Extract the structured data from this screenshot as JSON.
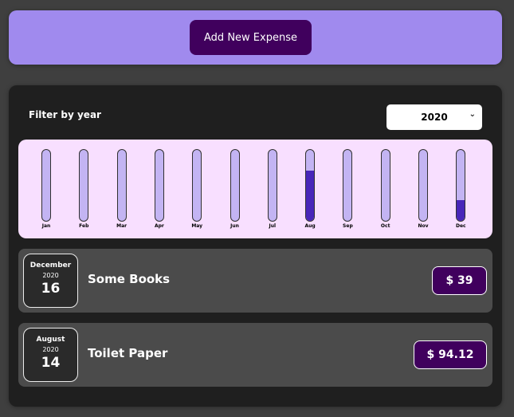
{
  "new_expense": {
    "add_button_label": "Add New Expense"
  },
  "filter": {
    "label": "Filter by year",
    "selected_year": "2020",
    "chevron_icon": "chevron-down-icon"
  },
  "chart_data": {
    "type": "bar",
    "categories": [
      "Jan",
      "Feb",
      "Mar",
      "Apr",
      "May",
      "Jun",
      "Jul",
      "Aug",
      "Sep",
      "Oct",
      "Nov",
      "Dec"
    ],
    "values": [
      0,
      0,
      0,
      0,
      0,
      0,
      0,
      94.12,
      0,
      0,
      0,
      39
    ],
    "ylim": [
      0,
      133.12
    ],
    "title": "",
    "xlabel": "",
    "ylabel": "",
    "colors": {
      "track": "#c3b4f3",
      "fill": "#4826b9",
      "background": "#f8dfff"
    }
  },
  "expenses": [
    {
      "month": "December",
      "year": "2020",
      "day": "16",
      "title": "Some Books",
      "amount": "$ 39"
    },
    {
      "month": "August",
      "year": "2020",
      "day": "14",
      "title": "Toilet Paper",
      "amount": "$ 94.12"
    }
  ],
  "colors": {
    "accent": "#a08aee",
    "button": "#40005d",
    "panel": "#1f1f1f",
    "item": "#4b4b4b"
  }
}
